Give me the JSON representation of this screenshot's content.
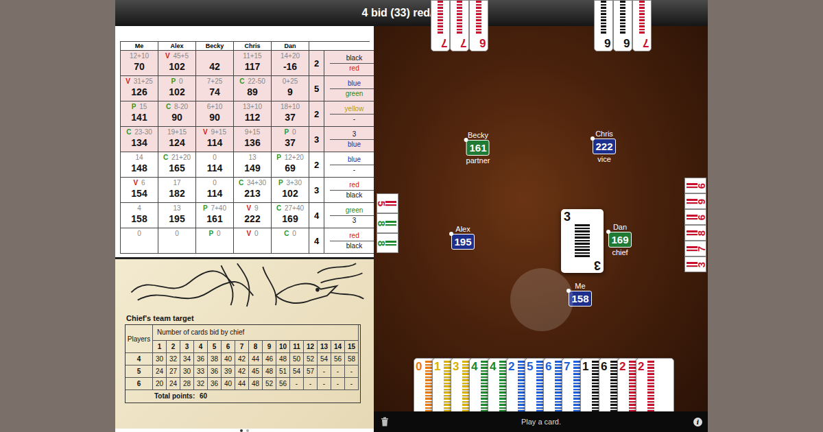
{
  "title": "4 bid (33) red/black",
  "score_table": {
    "columns": [
      "Me",
      "Alex",
      "Becky",
      "Chris",
      "Dan"
    ],
    "rows": [
      {
        "highlighted": true,
        "cells": [
          {
            "note": "12+10",
            "total": "70"
          },
          {
            "role": "V",
            "role_color": "#d01818",
            "note": "45+5",
            "total": "102"
          },
          {
            "note": "",
            "total": "42"
          },
          {
            "note": "11+15",
            "total": "117"
          },
          {
            "note": "14+20",
            "total": "-16"
          }
        ],
        "bid": "2",
        "trumps": [
          {
            "text": "black",
            "color": "#111111"
          },
          {
            "text": "red",
            "color": "#d01818"
          }
        ]
      },
      {
        "highlighted": true,
        "cells": [
          {
            "role": "V",
            "role_color": "#d01818",
            "note": "31+25",
            "total": "126"
          },
          {
            "role": "P",
            "role_color": "#2a9a2a",
            "note": "0",
            "total": "102"
          },
          {
            "note": "7+25",
            "total": "74"
          },
          {
            "role": "C",
            "role_color": "#2a9a2a",
            "note": "22-50",
            "total": "89"
          },
          {
            "note": "0+25",
            "total": "9"
          }
        ],
        "bid": "5",
        "trumps": [
          {
            "text": "blue",
            "color": "#1a2ab0"
          },
          {
            "text": "green",
            "color": "#1e8a1e"
          }
        ]
      },
      {
        "highlighted": true,
        "cells": [
          {
            "role": "P",
            "role_color": "#2a9a2a",
            "note": "15",
            "total": "141"
          },
          {
            "role": "C",
            "role_color": "#2a9a2a",
            "note": "8-20",
            "total": "90"
          },
          {
            "note": "6+10",
            "total": "90"
          },
          {
            "note": "13+10",
            "total": "112"
          },
          {
            "note": "18+10",
            "total": "37"
          }
        ],
        "bid": "2",
        "trumps": [
          {
            "text": "yellow",
            "color": "#b8a000"
          },
          {
            "text": "-",
            "color": "#111111"
          }
        ]
      },
      {
        "highlighted": true,
        "cells": [
          {
            "role": "C",
            "role_color": "#2a9a2a",
            "note": "23-30",
            "total": "134"
          },
          {
            "note": "19+15",
            "total": "124"
          },
          {
            "role": "V",
            "role_color": "#d01818",
            "note": "9+15",
            "total": "114"
          },
          {
            "note": "9+15",
            "total": "136"
          },
          {
            "role": "P",
            "role_color": "#2a9a2a",
            "note": "0",
            "total": "37"
          }
        ],
        "bid": "3",
        "trumps": [
          {
            "text": "3",
            "color": "#111111"
          },
          {
            "text": "blue",
            "color": "#1a2ab0"
          }
        ]
      },
      {
        "highlighted": false,
        "cells": [
          {
            "note": "14",
            "total": "148"
          },
          {
            "role": "C",
            "role_color": "#2a9a2a",
            "note": "21+20",
            "total": "165"
          },
          {
            "note": "0",
            "total": "114"
          },
          {
            "note": "13",
            "total": "149"
          },
          {
            "role": "P",
            "role_color": "#2a9a2a",
            "note": "12+20",
            "total": "69"
          }
        ],
        "bid": "2",
        "trumps": [
          {
            "text": "blue",
            "color": "#1a2ab0"
          },
          {
            "text": "-",
            "color": "#111111"
          }
        ]
      },
      {
        "highlighted": false,
        "cells": [
          {
            "role": "V",
            "role_color": "#d01818",
            "note": "6",
            "total": "154"
          },
          {
            "note": "17",
            "total": "182"
          },
          {
            "note": "0",
            "total": "114"
          },
          {
            "role": "C",
            "role_color": "#2a9a2a",
            "note": "34+30",
            "total": "213"
          },
          {
            "role": "P",
            "role_color": "#2a9a2a",
            "note": "3+30",
            "total": "102"
          }
        ],
        "bid": "3",
        "trumps": [
          {
            "text": "red",
            "color": "#d01818"
          },
          {
            "text": "black",
            "color": "#111111"
          }
        ]
      },
      {
        "highlighted": false,
        "cells": [
          {
            "note": "4",
            "total": "158"
          },
          {
            "note": "13",
            "total": "195"
          },
          {
            "role": "P",
            "role_color": "#2a9a2a",
            "note": "7+40",
            "total": "161"
          },
          {
            "role": "V",
            "role_color": "#d01818",
            "note": "9",
            "total": "222"
          },
          {
            "role": "C",
            "role_color": "#2a9a2a",
            "note": "27+40",
            "total": "169"
          }
        ],
        "bid": "4",
        "trumps": [
          {
            "text": "green",
            "color": "#1e8a1e"
          },
          {
            "text": "3",
            "color": "#111111"
          }
        ]
      },
      {
        "highlighted": false,
        "cells": [
          {
            "note": "0"
          },
          {
            "note": "0"
          },
          {
            "role": "P",
            "role_color": "#2a9a2a",
            "note": "0"
          },
          {
            "role": "V",
            "role_color": "#d01818",
            "note": "0"
          },
          {
            "role": "C",
            "role_color": "#2a9a2a",
            "note": "0"
          }
        ],
        "bid": "4",
        "trumps": [
          {
            "text": "red",
            "color": "#d01818"
          },
          {
            "text": "black",
            "color": "#111111"
          }
        ]
      }
    ]
  },
  "target_chart": {
    "title": "Chief's team target",
    "players_label": "Players",
    "header": "Number of cards bid by chief",
    "columns": [
      "1",
      "2",
      "3",
      "4",
      "5",
      "6",
      "7",
      "8",
      "9",
      "10",
      "11",
      "12",
      "13",
      "14",
      "15"
    ],
    "rows": [
      {
        "players": "4",
        "values": [
          "30",
          "32",
          "34",
          "36",
          "38",
          "40",
          "42",
          "44",
          "46",
          "48",
          "50",
          "52",
          "54",
          "56",
          "58"
        ]
      },
      {
        "players": "5",
        "values": [
          "24",
          "27",
          "30",
          "33",
          "36",
          "39",
          "42",
          "45",
          "48",
          "51",
          "54",
          "57",
          "-",
          "-",
          "-"
        ]
      },
      {
        "players": "6",
        "values": [
          "20",
          "24",
          "28",
          "32",
          "36",
          "40",
          "44",
          "48",
          "52",
          "56",
          "-",
          "-",
          "-",
          "-",
          "-"
        ]
      }
    ],
    "total_label": "Total points:",
    "total_value": "60"
  },
  "pages": [
    {
      "selected": true
    },
    {
      "selected": false
    }
  ],
  "players": [
    {
      "name": "Becky",
      "score": "161",
      "role": "partner",
      "color": "#1f7a34"
    },
    {
      "name": "Chris",
      "score": "222",
      "role": "vice",
      "color": "#1d2e8c"
    },
    {
      "name": "Alex",
      "score": "195",
      "color": "#1d2e8c"
    },
    {
      "name": "Dan",
      "score": "169",
      "role": "chief",
      "color": "#1f7a34"
    },
    {
      "name": "Me",
      "score": "158",
      "color": "#1d2e8c"
    }
  ],
  "played_card": {
    "rank": "3",
    "color": "#111111"
  },
  "top_left_cards": [
    {
      "rank": "7",
      "color": "#c8102e"
    },
    {
      "rank": "7",
      "color": "#c8102e"
    },
    {
      "rank": "6",
      "color": "#c8102e"
    }
  ],
  "top_right_cards": [
    {
      "rank": "6",
      "color": "#111111"
    },
    {
      "rank": "6",
      "color": "#111111"
    },
    {
      "rank": "7",
      "color": "#c8102e"
    }
  ],
  "left_edge_cards": [
    {
      "rank": "5",
      "color": "#c8102e"
    },
    {
      "rank": "8",
      "color": "#1e8a2e"
    },
    {
      "rank": "8",
      "color": "#1e8a2e"
    }
  ],
  "right_edge_cards": [
    {
      "rank": "6",
      "color": "#c8102e"
    },
    {
      "rank": "9",
      "color": "#c8102e"
    },
    {
      "rank": "6",
      "color": "#c8102e"
    },
    {
      "rank": "8",
      "color": "#c8102e"
    },
    {
      "rank": "7",
      "color": "#c8102e"
    },
    {
      "rank": "3",
      "color": "#c8102e"
    }
  ],
  "hand": [
    {
      "rank": "0",
      "color": "#e87a10"
    },
    {
      "rank": "1",
      "color": "#d8b000"
    },
    {
      "rank": "3",
      "color": "#d8b000"
    },
    {
      "rank": "4",
      "color": "#1e8a2e"
    },
    {
      "rank": "4",
      "color": "#1e8a2e"
    },
    {
      "rank": "2",
      "color": "#1e5ed8"
    },
    {
      "rank": "5",
      "color": "#1e5ed8"
    },
    {
      "rank": "6",
      "color": "#1e5ed8"
    },
    {
      "rank": "7",
      "color": "#1e5ed8"
    },
    {
      "rank": "1",
      "color": "#111111"
    },
    {
      "rank": "6",
      "color": "#111111"
    },
    {
      "rank": "2",
      "color": "#c8102e"
    },
    {
      "rank": "2",
      "color": "#c8102e"
    }
  ],
  "status_bar": {
    "message": "Play a card.",
    "info_icon": "i"
  }
}
